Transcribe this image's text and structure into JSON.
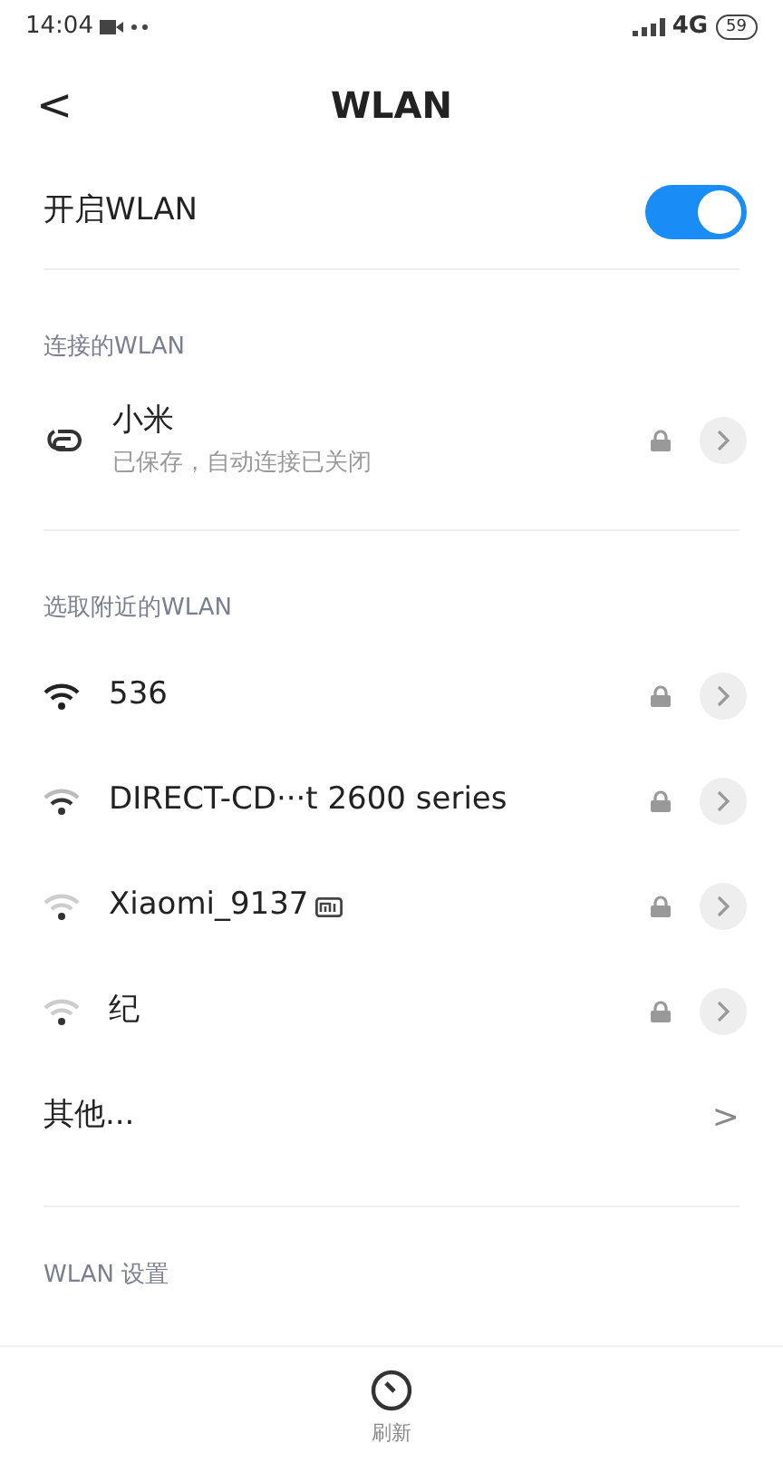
{
  "status_bar": {
    "time": "14:04",
    "network": "4G",
    "battery": "59"
  },
  "header": {
    "back": "<",
    "title": "WLAN"
  },
  "toggle": {
    "label": "开启WLAN",
    "on": true
  },
  "connected": {
    "heading": "连接的WLAN",
    "network": {
      "name": "小米",
      "subtitle": "已保存，自动连接已关闭",
      "locked": true
    }
  },
  "nearby": {
    "heading": "选取附近的WLAN",
    "networks": [
      {
        "name": "536",
        "kind": "strong",
        "locked": true,
        "mi_badge": false
      },
      {
        "name": "DIRECT-CD···t 2600 series",
        "kind": "medium",
        "locked": true,
        "mi_badge": false
      },
      {
        "name": "Xiaomi_9137",
        "kind": "weak",
        "locked": true,
        "mi_badge": true
      },
      {
        "name": "纪",
        "kind": "weak",
        "locked": true,
        "mi_badge": false
      }
    ]
  },
  "other": {
    "label": "其他...",
    "arrow": ">"
  },
  "settings_heading": "WLAN 设置",
  "bottom_bar": {
    "refresh_label": "刷新"
  }
}
